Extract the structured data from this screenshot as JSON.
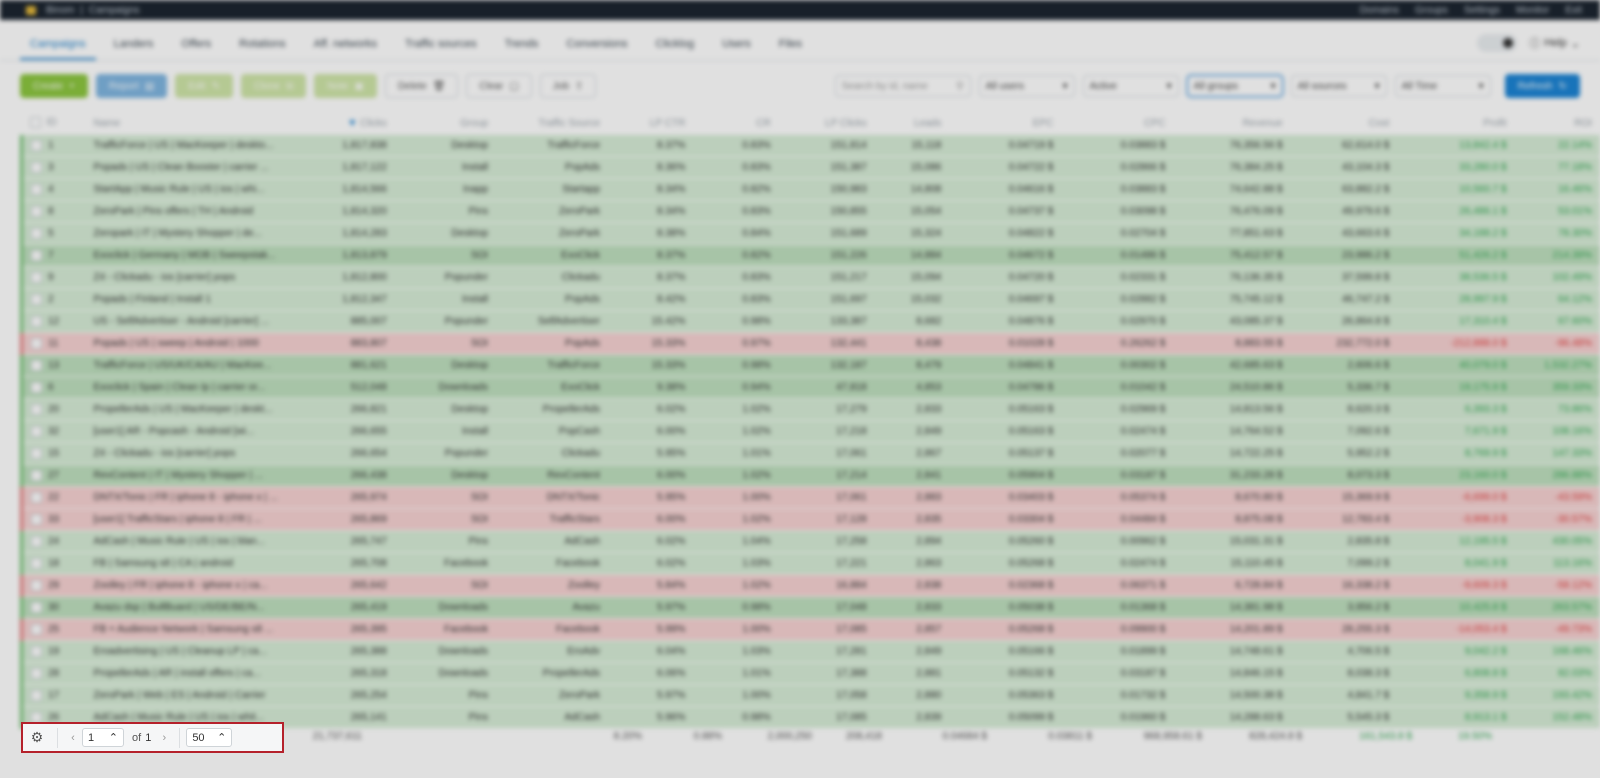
{
  "titlebar": {
    "app": "Binom",
    "section": "Campaigns",
    "links": [
      "Domains",
      "Groups",
      "Settings",
      "Monitor",
      "Exit"
    ]
  },
  "nav": {
    "tabs": [
      "Campaigns",
      "Landers",
      "Offers",
      "Rotations",
      "Aff. networks",
      "Traffic sources",
      "Trends",
      "Conversions",
      "Clicklog",
      "Users",
      "Files"
    ],
    "help": "Help"
  },
  "toolbar": {
    "create": "Create",
    "report": "Report",
    "edit": "Edit",
    "clone": "Clone",
    "note": "Note",
    "delete": "Delete",
    "clear": "Clear",
    "job": "Job",
    "search_placeholder": "Search by id, name",
    "users": "All users",
    "status": "Active",
    "groups": "All groups",
    "sources": "All sources",
    "period": "All Time",
    "refresh": "Refresh"
  },
  "columns": [
    "ID",
    "Name",
    "Clicks",
    "Group",
    "Traffic Source",
    "LP CTR",
    "CR",
    "LP Clicks",
    "Leads",
    "EPC",
    "CPC",
    "Revenue",
    "Cost",
    "Profit",
    "ROI"
  ],
  "rows": [
    {
      "t": "pos",
      "id": "1",
      "name": "TrafficForce | US | MacKeeper | deskto...",
      "clicks": "1,817,838",
      "group": "Desktop",
      "src": "TrafficForce",
      "lpctr": "8.37%",
      "cr": "0.83%",
      "lpc": "151,814",
      "leads": "15,118",
      "epc": "0.04719 $",
      "cpc": "0.03883 $",
      "rev": "76,356.56 $",
      "cost": "62,614.0 $",
      "profit": "13,842.4 $",
      "roi": "22.14%",
      "pc": "g"
    },
    {
      "t": "pos",
      "id": "3",
      "name": "Popads | US | Clean Booster | carrier ...",
      "clicks": "1,817,122",
      "group": "Install",
      "src": "PopAds",
      "lpctr": "8.36%",
      "cr": "0.83%",
      "lpc": "151,387",
      "leads": "15,086",
      "epc": "0.04722 $",
      "cpc": "0.02866 $",
      "rev": "76,384.25 $",
      "cost": "43,104.3 $",
      "profit": "33,280.0 $",
      "roi": "77.18%",
      "pc": "g"
    },
    {
      "t": "pos",
      "id": "4",
      "name": "StartApp | Music Rule | US | ios | whi...",
      "clicks": "1,814,566",
      "group": "Inapp",
      "src": "Startapp",
      "lpctr": "8.34%",
      "cr": "0.82%",
      "lpc": "150,983",
      "leads": "14,808",
      "epc": "0.04616 $",
      "cpc": "0.03883 $",
      "rev": "74,642.88 $",
      "cost": "63,882.2 $",
      "profit": "10,560.7 $",
      "roi": "16.46%",
      "pc": "g"
    },
    {
      "t": "pos",
      "id": "8",
      "name": "ZeroPark | Pins offers | TH | Android",
      "clicks": "1,814,320",
      "group": "Pins",
      "src": "ZeroPark",
      "lpctr": "8.34%",
      "cr": "0.83%",
      "lpc": "150,855",
      "leads": "15,054",
      "epc": "0.04737 $",
      "cpc": "0.03098 $",
      "rev": "76,476.09 $",
      "cost": "49,979.6 $",
      "profit": "26,486.1 $",
      "roi": "53.01%",
      "pc": "g"
    },
    {
      "t": "pos",
      "id": "5",
      "name": "Zeropark | IT | Mystery Shopper | de...",
      "clicks": "1,814,283",
      "group": "Desktop",
      "src": "ZeroPark",
      "lpctr": "8.38%",
      "cr": "0.84%",
      "lpc": "151,689",
      "leads": "15,324",
      "epc": "0.04822 $",
      "cpc": "0.02704 $",
      "rev": "77,851.63 $",
      "cost": "43,663.6 $",
      "profit": "34,188.2 $",
      "roi": "78.30%",
      "pc": "g"
    },
    {
      "t": "pos deep",
      "id": "7",
      "name": "Exoclick | Germany | MOB | Sweepstak...",
      "clicks": "1,813,879",
      "group": "SOI",
      "src": "ExoClick",
      "lpctr": "8.37%",
      "cr": "0.82%",
      "lpc": "151,226",
      "leads": "14,884",
      "epc": "0.04672 $",
      "cpc": "0.01486 $",
      "rev": "75,412.57 $",
      "cost": "23,986.2 $",
      "profit": "51,426.2 $",
      "roi": "214.39%",
      "pc": "g"
    },
    {
      "t": "pos",
      "id": "9",
      "name": "Z4 - Clickadu - ios [carrier] pops",
      "clicks": "1,812,800",
      "group": "Popunder",
      "src": "Clickadu",
      "lpctr": "8.37%",
      "cr": "0.83%",
      "lpc": "151,217",
      "leads": "15,094",
      "epc": "0.04720 $",
      "cpc": "0.02331 $",
      "rev": "76,136.35 $",
      "cost": "37,599.8 $",
      "profit": "38,536.5 $",
      "roi": "102.49%",
      "pc": "g"
    },
    {
      "t": "pos",
      "id": "2",
      "name": "Popads | Finland | Install 1",
      "clicks": "1,812,347",
      "group": "Install",
      "src": "PopAds",
      "lpctr": "8.42%",
      "cr": "0.83%",
      "lpc": "151,697",
      "leads": "15,032",
      "epc": "0.04697 $",
      "cpc": "0.02882 $",
      "rev": "75,745.12 $",
      "cost": "46,747.2 $",
      "profit": "28,997.9 $",
      "roi": "64.12%",
      "pc": "g"
    },
    {
      "t": "pos",
      "id": "12",
      "name": "US - SelfAdvertiser - Android [carrier] ...",
      "clicks": "885,007",
      "group": "Popunder",
      "src": "SelfAdvertiser",
      "lpctr": "15.42%",
      "cr": "0.98%",
      "lpc": "133,387",
      "leads": "8,682",
      "epc": "0.04876 $",
      "cpc": "0.02970 $",
      "rev": "43,085.37 $",
      "cost": "26,864.8 $",
      "profit": "17,310.4 $",
      "roi": "67.60%",
      "pc": "g"
    },
    {
      "t": "neg",
      "id": "11",
      "name": "Popads | US | sweep | Android | 1000",
      "clicks": "883,807",
      "group": "SOI",
      "src": "PopAds",
      "lpctr": "15.33%",
      "cr": "0.97%",
      "lpc": "132,441",
      "leads": "8,438",
      "epc": "0.01028 $",
      "cpc": "0.26262 $",
      "rev": "8,883.55 $",
      "cost": "232,772.0 $",
      "profit": "-212,888.0 $",
      "roi": "-96.48%",
      "pc": "b"
    },
    {
      "t": "pos deep",
      "id": "13",
      "name": "TrafficForce | US/UK/CA/AU | MacKee...",
      "clicks": "881,621",
      "group": "Desktop",
      "src": "TrafficForce",
      "lpctr": "15.33%",
      "cr": "0.98%",
      "lpc": "132,187",
      "leads": "8,479",
      "epc": "0.04841 $",
      "cpc": "0.00302 $",
      "rev": "42,685.63 $",
      "cost": "2,606.6 $",
      "profit": "40,079.0 $",
      "roi": "1,532.27%",
      "pc": "g"
    },
    {
      "t": "pos deep",
      "id": "6",
      "name": "Exoclick | Spain | Clean Ip | carrier or...",
      "clicks": "512,048",
      "group": "Downloads",
      "src": "ExoClick",
      "lpctr": "9.38%",
      "cr": "0.94%",
      "lpc": "47,818",
      "leads": "4,853",
      "epc": "0.04786 $",
      "cpc": "0.01042 $",
      "rev": "24,510.86 $",
      "cost": "5,336.7 $",
      "profit": "19,175.9 $",
      "roi": "359.33%",
      "pc": "g"
    },
    {
      "t": "pos",
      "id": "20",
      "name": "PropellerAds | US | MacKeeper | deskt...",
      "clicks": "266,821",
      "group": "Desktop",
      "src": "PropellerAds",
      "lpctr": "6.02%",
      "cr": "1.02%",
      "lpc": "17,279",
      "leads": "2,833",
      "epc": "0.05163 $",
      "cpc": "0.02969 $",
      "rev": "14,813.56 $",
      "cost": "8,620.3 $",
      "profit": "6,393.3 $",
      "roi": "73.86%",
      "pc": "g"
    },
    {
      "t": "pos",
      "id": "32",
      "name": "[user1] AR - Popcash - Android [wi...",
      "clicks": "266,655",
      "group": "Install",
      "src": "PopCash",
      "lpctr": "6.00%",
      "cr": "1.02%",
      "lpc": "17,218",
      "leads": "2,849",
      "epc": "0.05163 $",
      "cpc": "0.02474 $",
      "rev": "14,764.52 $",
      "cost": "7,092.6 $",
      "profit": "7,671.9 $",
      "roi": "108.16%",
      "pc": "g"
    },
    {
      "t": "pos",
      "id": "15",
      "name": "Z4 - Clickadu - ios [carrier] pops",
      "clicks": "266,654",
      "group": "Popunder",
      "src": "Clickadu",
      "lpctr": "5.95%",
      "cr": "1.01%",
      "lpc": "17,061",
      "leads": "2,867",
      "epc": "0.05137 $",
      "cpc": "0.02077 $",
      "rev": "14,722.25 $",
      "cost": "5,952.2 $",
      "profit": "8,769.9 $",
      "roi": "147.33%",
      "pc": "g"
    },
    {
      "t": "pos deep",
      "id": "27",
      "name": "RevContent | IT | Mystery Shopper | ...",
      "clicks": "266,438",
      "group": "Desktop",
      "src": "RevContent",
      "lpctr": "6.00%",
      "cr": "1.02%",
      "lpc": "17,214",
      "leads": "2,841",
      "epc": "0.05904 $",
      "cpc": "0.03187 $",
      "rev": "31,233.28 $",
      "cost": "8,073.3 $",
      "profit": "23,160.0 $",
      "roi": "286.88%",
      "pc": "g"
    },
    {
      "t": "neg",
      "id": "22",
      "name": "DNTX/Tonic | FR | iphone 8 - iphone x | ...",
      "clicks": "265,974",
      "group": "SOI",
      "src": "DNTX/Tonic",
      "lpctr": "5.95%",
      "cr": "1.00%",
      "lpc": "17,061",
      "leads": "2,883",
      "epc": "0.03403 $",
      "cpc": "0.05374 $",
      "rev": "8,670.80 $",
      "cost": "15,369.9 $",
      "profit": "-6,699.0 $",
      "roi": "-43.59%",
      "pc": "b"
    },
    {
      "t": "neg",
      "id": "33",
      "name": "[user1] TrafficStars | iphone 8 | FR | ...",
      "clicks": "265,869",
      "group": "SOI",
      "src": "TrafficStars",
      "lpctr": "6.00%",
      "cr": "1.02%",
      "lpc": "17,128",
      "leads": "2,835",
      "epc": "0.03304 $",
      "cpc": "0.04484 $",
      "rev": "8,875.08 $",
      "cost": "12,783.4 $",
      "profit": "-3,908.3 $",
      "roi": "-30.57%",
      "pc": "b"
    },
    {
      "t": "pos",
      "id": "24",
      "name": "AdCash | Music Rule | US | ios | blan...",
      "clicks": "265,747",
      "group": "Pins",
      "src": "AdCash",
      "lpctr": "6.02%",
      "cr": "1.04%",
      "lpc": "17,258",
      "leads": "2,894",
      "epc": "0.05260 $",
      "cpc": "0.00962 $",
      "rev": "15,031.31 $",
      "cost": "2,835.8 $",
      "profit": "12,195.5 $",
      "roi": "430.05%",
      "pc": "g"
    },
    {
      "t": "pos",
      "id": "18",
      "name": "FB | Samsung s8 | CA | android",
      "clicks": "265,708",
      "group": "Facebook",
      "src": "Facebook",
      "lpctr": "6.02%",
      "cr": "1.03%",
      "lpc": "17,221",
      "leads": "2,863",
      "epc": "0.05268 $",
      "cpc": "0.02474 $",
      "rev": "15,110.45 $",
      "cost": "7,099.2 $",
      "profit": "8,041.9 $",
      "roi": "113.16%",
      "pc": "g"
    },
    {
      "t": "neg",
      "id": "29",
      "name": "Zoolley | FR | iphone 8 - iphone x | ca...",
      "clicks": "265,642",
      "group": "SOI",
      "src": "Zoolley",
      "lpctr": "5.84%",
      "cr": "1.02%",
      "lpc": "16,884",
      "leads": "2,838",
      "epc": "0.02368 $",
      "cpc": "0.06371 $",
      "rev": "6,728.84 $",
      "cost": "16,338.2 $",
      "profit": "-9,609.3 $",
      "roi": "-58.12%",
      "pc": "b"
    },
    {
      "t": "pos deep",
      "id": "30",
      "name": "Avazu dsp | BullBuard | US/DE/BE/N...",
      "clicks": "265,419",
      "group": "Downloads",
      "src": "Avazu",
      "lpctr": "5.97%",
      "cr": "0.98%",
      "lpc": "17,048",
      "leads": "2,833",
      "epc": "0.05038 $",
      "cpc": "0.01368 $",
      "rev": "14,381.98 $",
      "cost": "3,956.2 $",
      "profit": "10,425.8 $",
      "roi": "263.57%",
      "pc": "g"
    },
    {
      "t": "neg",
      "id": "25",
      "name": "FB + Audience Network | Samsung s8 ...",
      "clicks": "265,395",
      "group": "Facebook",
      "src": "Facebook",
      "lpctr": "5.99%",
      "cr": "1.00%",
      "lpc": "17,085",
      "leads": "2,857",
      "epc": "0.05268 $",
      "cpc": "0.09900 $",
      "rev": "14,201.89 $",
      "cost": "28,255.3 $",
      "profit": "-14,053.4 $",
      "roi": "-49.73%",
      "pc": "b"
    },
    {
      "t": "pos",
      "id": "19",
      "name": "Eroadvertising | US | Cleanup LP | ca...",
      "clicks": "265,388",
      "group": "Downloads",
      "src": "EroAdv",
      "lpctr": "6.04%",
      "cr": "1.03%",
      "lpc": "17,281",
      "leads": "2,849",
      "epc": "0.05166 $",
      "cpc": "0.01899 $",
      "rev": "14,748.61 $",
      "cost": "4,706.5 $",
      "profit": "9,042.2 $",
      "roi": "168.46%",
      "pc": "g"
    },
    {
      "t": "pos",
      "id": "28",
      "name": "PropellerAds | AR | install offers | ca...",
      "clicks": "265,318",
      "group": "Downloads",
      "src": "PropellerAds",
      "lpctr": "6.06%",
      "cr": "1.01%",
      "lpc": "17,388",
      "leads": "2,881",
      "epc": "0.05132 $",
      "cpc": "0.03187 $",
      "rev": "14,846.15 $",
      "cost": "8,038.3 $",
      "profit": "6,808.8 $",
      "roi": "82.03%",
      "pc": "g"
    },
    {
      "t": "pos",
      "id": "17",
      "name": "ZeroPark | Web | ES | Android | Carrier",
      "clicks": "265,254",
      "group": "Pins",
      "src": "ZeroPark",
      "lpctr": "5.97%",
      "cr": "1.00%",
      "lpc": "17,058",
      "leads": "2,880",
      "epc": "0.05363 $",
      "cpc": "0.01732 $",
      "rev": "14,500.38 $",
      "cost": "4,841.7 $",
      "profit": "9,358.9 $",
      "roi": "193.42%",
      "pc": "g"
    },
    {
      "t": "pos",
      "id": "26",
      "name": "AdCash | Music Rule | US | ios | whit...",
      "clicks": "265,141",
      "group": "Pins",
      "src": "AdCash",
      "lpctr": "5.96%",
      "cr": "0.98%",
      "lpc": "17,085",
      "leads": "2,839",
      "epc": "0.05099 $",
      "cpc": "0.01960 $",
      "rev": "14,288.63 $",
      "cost": "5,545.3 $",
      "profit": "8,913.1 $",
      "roi": "152.48%",
      "pc": "g"
    }
  ],
  "totals": {
    "clicks": "21,737,611",
    "lpctr": "8.20%",
    "cr": "0.88%",
    "lpc": "2,000,250",
    "leads": "208,418",
    "epc": "0.04684 $",
    "cpc": "0.03811 $",
    "rev": "968,958.61 $",
    "cost": "828,424.8 $",
    "profit": "161,543.8 $",
    "roi": "19.50%"
  },
  "pager": {
    "page": "1",
    "of": "of",
    "total_pages": "1",
    "per_page": "50"
  }
}
